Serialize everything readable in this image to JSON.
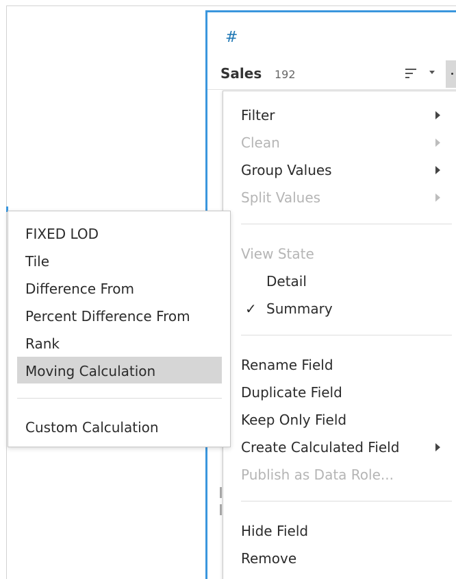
{
  "field": {
    "type_icon": "#",
    "name": "Sales",
    "count": "192"
  },
  "context_menu": {
    "items": [
      {
        "label": "Filter",
        "disabled": false,
        "submenu": true
      },
      {
        "label": "Clean",
        "disabled": true,
        "submenu": true
      },
      {
        "label": "Group Values",
        "disabled": false,
        "submenu": true
      },
      {
        "label": "Split Values",
        "disabled": true,
        "submenu": true
      }
    ],
    "view_state": {
      "header": "View State",
      "detail": "Detail",
      "summary": "Summary",
      "checked_icon": "✓"
    },
    "field_actions": [
      {
        "label": "Rename Field"
      },
      {
        "label": "Duplicate Field"
      },
      {
        "label": "Keep Only Field"
      },
      {
        "label": "Create Calculated Field"
      },
      {
        "label": "Publish as Data Role..."
      }
    ],
    "final_actions": [
      {
        "label": "Hide Field"
      },
      {
        "label": "Remove"
      }
    ]
  },
  "submenu": {
    "items": [
      {
        "label": "FIXED LOD"
      },
      {
        "label": "Tile"
      },
      {
        "label": "Difference From"
      },
      {
        "label": "Percent Difference From"
      },
      {
        "label": "Rank"
      },
      {
        "label": "Moving Calculation"
      },
      {
        "label": "Custom Calculation"
      }
    ],
    "highlighted": "Moving Calculation"
  },
  "colors": {
    "selection_border": "#3a96dd",
    "hover_highlight": "#d6d6d6",
    "disabled_text": "#b5b5b5"
  }
}
